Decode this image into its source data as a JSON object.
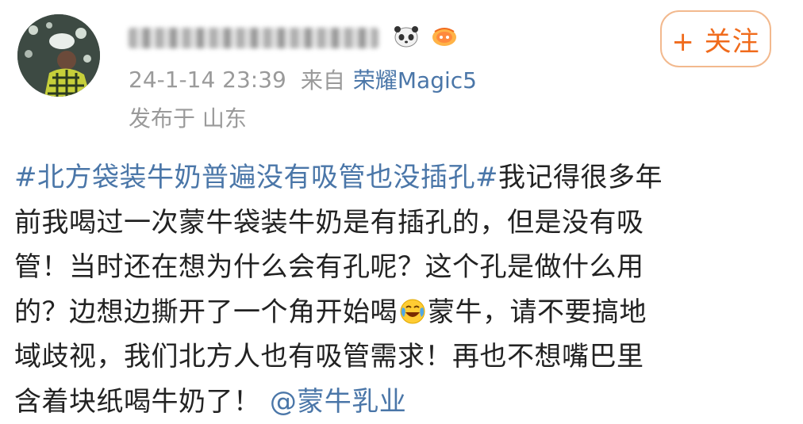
{
  "post": {
    "timestamp": "24-1-14 23:39",
    "from_label": "来自",
    "source_device": "荣耀Magic5",
    "location": "发布于 山东",
    "follow_label": "+ 关注"
  },
  "content": {
    "hashtag": "#北方袋装牛奶普遍没有吸管也没插孔#",
    "line1_rest": "我记得很多年",
    "line2": "前我喝过一次蒙牛袋装牛奶是有插孔的，但是没有吸",
    "line3": "管！当时还在想为什么会有孔呢？这个孔是做什么用",
    "line4_a": "的？边想边撕开了一个角开始喝",
    "line4_b": "蒙牛，请不要搞地",
    "line5": "域歧视，我们北方人也有吸管需求！再也不想嘴巴里",
    "line6": "含着块纸喝牛奶了！",
    "mention": "@蒙牛乳业"
  },
  "icons": {
    "emoji": "laughing-crying-emoji-icon",
    "badge1": "panda-badge-icon",
    "badge2": "orange-badge-icon"
  },
  "colors": {
    "link": "#4a76a8",
    "follow": "#f06b1c",
    "meta": "#9a9a9a"
  }
}
